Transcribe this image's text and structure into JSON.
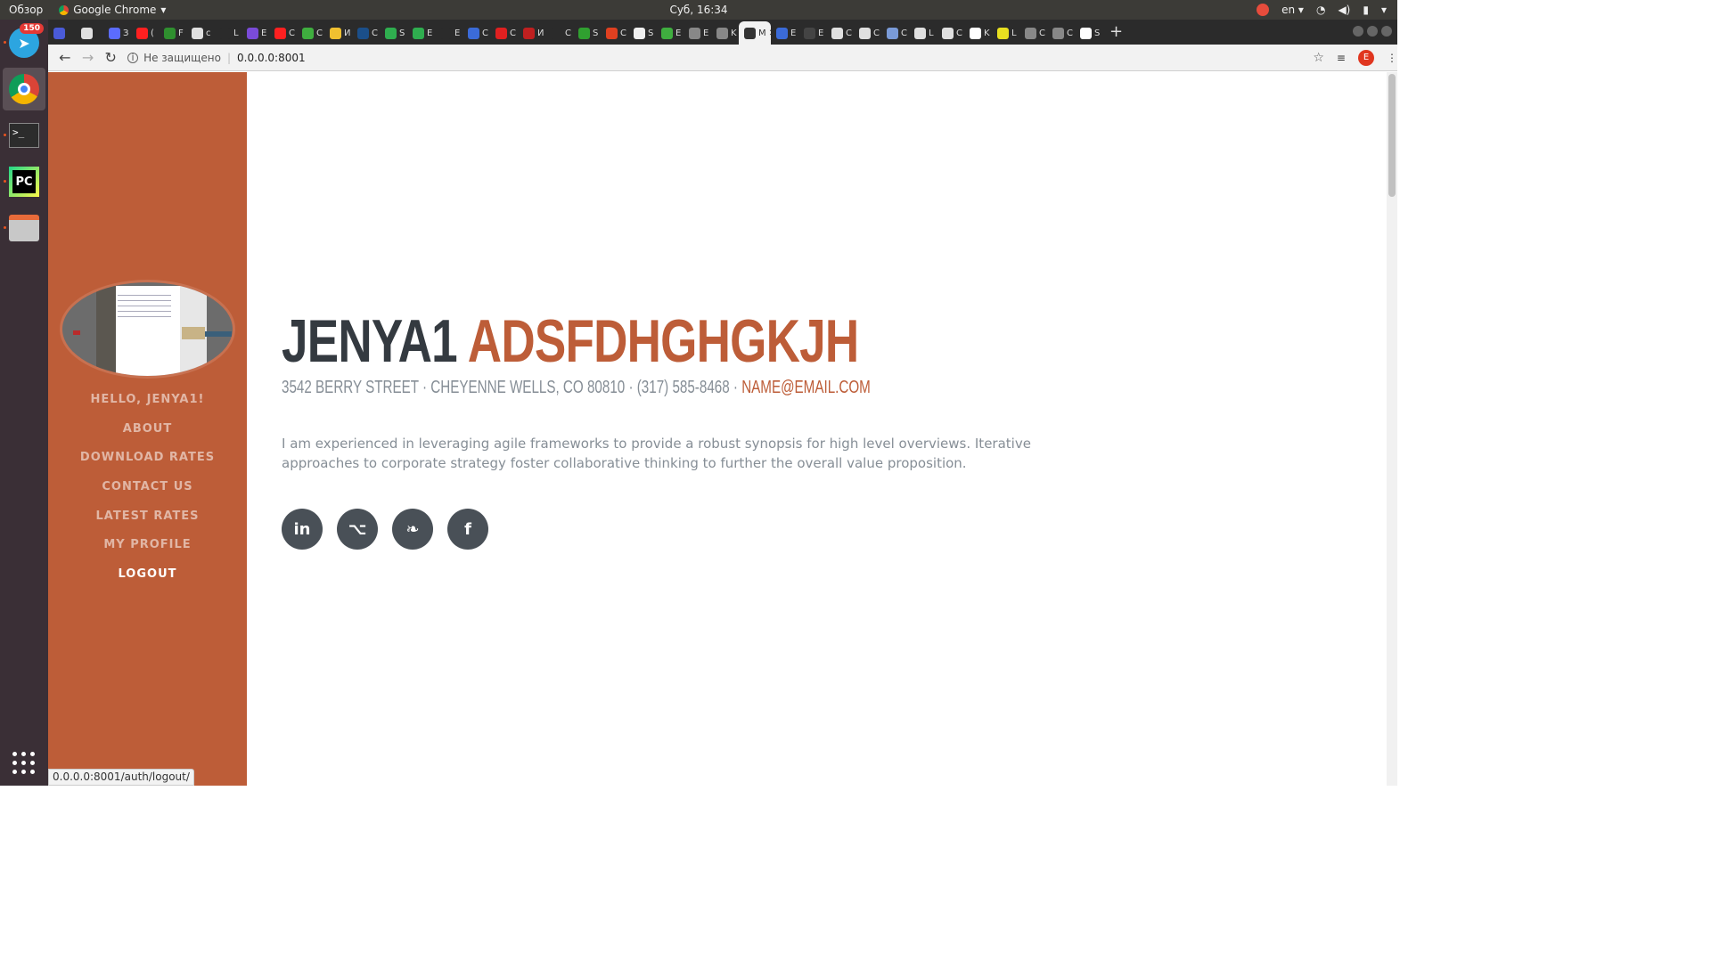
{
  "os": {
    "overview_label": "Обзор",
    "app_label": "Google Chrome",
    "clock": "Суб, 16:34",
    "language": "en",
    "notification_count": "150"
  },
  "dock": {
    "telegram_badge": "150",
    "items": [
      "telegram-icon",
      "chrome-icon",
      "terminal-icon",
      "pycharm-icon",
      "files-icon"
    ],
    "pycharm_label": "PC"
  },
  "browser": {
    "security_label": "Не защищено",
    "url": "0.0.0.0:8001",
    "status_url": "0.0.0.0:8001/auth/logout/",
    "avatar_letter": "E",
    "tabs": [
      {
        "icon": "tab-icon",
        "color": "#4a5bd8",
        "letter": ""
      },
      {
        "icon": "github-icon",
        "color": "#e0e0e0",
        "letter": ""
      },
      {
        "icon": "zoom-icon",
        "color": "#5b6cff",
        "letter": "З"
      },
      {
        "icon": "youtube-icon",
        "color": "#ff2020",
        "letter": "("
      },
      {
        "icon": "tab-icon",
        "color": "#2f8f2f",
        "letter": "F"
      },
      {
        "icon": "github-icon",
        "color": "#e0e0e0",
        "letter": "c"
      },
      {
        "icon": "tab-icon",
        "color": "#2b2b2b",
        "letter": "L"
      },
      {
        "icon": "mail-icon",
        "color": "#7a4bd8",
        "letter": "E"
      },
      {
        "icon": "youtube-icon",
        "color": "#ff2020",
        "letter": "C"
      },
      {
        "icon": "tab-icon",
        "color": "#3fae3f",
        "letter": "C"
      },
      {
        "icon": "python-icon",
        "color": "#f0c030",
        "letter": "И"
      },
      {
        "icon": "steam-icon",
        "color": "#1b4f8a",
        "letter": "C"
      },
      {
        "icon": "tab-icon",
        "color": "#2fae4f",
        "letter": "S"
      },
      {
        "icon": "tab-icon",
        "color": "#2fae4f",
        "letter": "E"
      },
      {
        "icon": "tab-icon",
        "color": "#2b2b2b",
        "letter": "E"
      },
      {
        "icon": "tab-icon",
        "color": "#3b6bd8",
        "letter": "C"
      },
      {
        "icon": "tab-icon",
        "color": "#e02020",
        "letter": "C"
      },
      {
        "icon": "tab-icon",
        "color": "#c02020",
        "letter": "И"
      },
      {
        "icon": "tab-icon",
        "color": "#2b2b2b",
        "letter": "C"
      },
      {
        "icon": "tab-icon",
        "color": "#30a030",
        "letter": "S"
      },
      {
        "icon": "tab-icon",
        "color": "#e04020",
        "letter": "C"
      },
      {
        "icon": "tab-icon",
        "color": "#f0f0f0",
        "letter": "S"
      },
      {
        "icon": "tab-icon",
        "color": "#3fae3f",
        "letter": "E"
      },
      {
        "icon": "tab-icon",
        "color": "#888888",
        "letter": "E"
      },
      {
        "icon": "tab-icon",
        "color": "#888888",
        "letter": "K"
      },
      {
        "icon": "tab-icon",
        "color": "#333333",
        "letter": "M",
        "active": true
      },
      {
        "icon": "tab-icon",
        "color": "#3b6bd8",
        "letter": "E"
      },
      {
        "icon": "tab-icon",
        "color": "#444444",
        "letter": "E"
      },
      {
        "icon": "github-icon",
        "color": "#e0e0e0",
        "letter": "C"
      },
      {
        "icon": "github-icon",
        "color": "#e0e0e0",
        "letter": "C"
      },
      {
        "icon": "tab-icon",
        "color": "#7a9bd8",
        "letter": "C"
      },
      {
        "icon": "github-icon",
        "color": "#e0e0e0",
        "letter": "L"
      },
      {
        "icon": "github-icon",
        "color": "#e0e0e0",
        "letter": "C"
      },
      {
        "icon": "google-icon",
        "color": "#ffffff",
        "letter": "K"
      },
      {
        "icon": "tab-icon",
        "color": "#e8e020",
        "letter": "L"
      },
      {
        "icon": "tab-icon",
        "color": "#888888",
        "letter": "C"
      },
      {
        "icon": "tab-icon",
        "color": "#888888",
        "letter": "C"
      },
      {
        "icon": "google-icon",
        "color": "#ffffff",
        "letter": "S"
      }
    ]
  },
  "sidebar": {
    "nav": [
      {
        "label": "HELLO, JENYA1!",
        "active": false
      },
      {
        "label": "ABOUT",
        "active": false
      },
      {
        "label": "DOWNLOAD RATES",
        "active": false
      },
      {
        "label": "CONTACT US",
        "active": false
      },
      {
        "label": "LATEST RATES",
        "active": false
      },
      {
        "label": "MY PROFILE",
        "active": false
      },
      {
        "label": "LOGOUT",
        "active": true
      }
    ]
  },
  "about": {
    "first_name": "JENYA1",
    "last_name": "ADSFDHGHGKJH",
    "address": "3542 BERRY STREET · CHEYENNE WELLS, CO 80810 · (317) 585-8468 ·",
    "email": "NAME@EMAIL.COM",
    "lead": "I am experienced in leveraging agile frameworks to provide a robust synopsis for high level overviews. Iterative approaches to corporate strategy foster collaborative thinking to further the overall value proposition.",
    "socials": [
      {
        "name": "linkedin-icon",
        "glyph": "in"
      },
      {
        "name": "github-icon",
        "glyph": "⌥"
      },
      {
        "name": "twitter-icon",
        "glyph": "❧"
      },
      {
        "name": "facebook-icon",
        "glyph": "f"
      }
    ]
  },
  "colors": {
    "accent": "#bd5d38",
    "heading": "#343a40",
    "muted": "#868e96",
    "social_bg": "#495057"
  }
}
